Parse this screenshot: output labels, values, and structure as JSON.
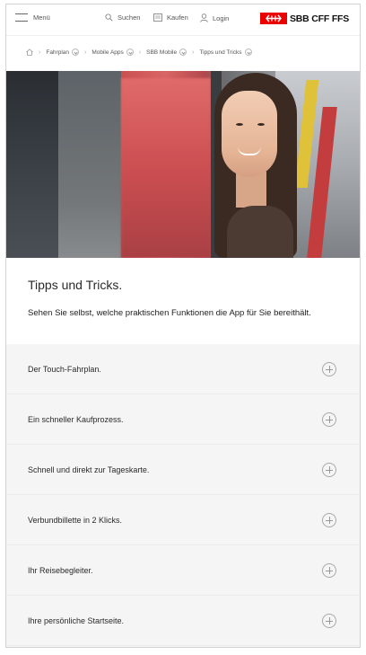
{
  "header": {
    "menu_label": "Menü",
    "search_label": "Suchen",
    "buy_label": "Kaufen",
    "login_label": "Login",
    "logo_text": "SBB CFF FFS",
    "brand_color": "#eb0000"
  },
  "breadcrumb": {
    "items": [
      {
        "label": "Fahrplan"
      },
      {
        "label": "Mobile Apps"
      },
      {
        "label": "SBB Mobile"
      },
      {
        "label": "Tipps und Tricks"
      }
    ]
  },
  "intro": {
    "title": "Tipps und Tricks.",
    "text": "Sehen Sie selbst, welche praktischen Funktionen die App für Sie bereithält."
  },
  "accordion": {
    "items": [
      {
        "label": "Der Touch-Fahrplan."
      },
      {
        "label": "Ein schneller Kaufprozess."
      },
      {
        "label": "Schnell und direkt zur Tageskarte."
      },
      {
        "label": "Verbundbillette in 2 Klicks."
      },
      {
        "label": "Ihr Reisebegleiter."
      },
      {
        "label": "Ihre persönliche Startseite."
      }
    ]
  },
  "icons": {
    "menu": "hamburger-icon",
    "search": "search-icon",
    "buy": "ticket-icon",
    "login": "user-icon",
    "home": "home-icon",
    "expand": "plus-circle-icon"
  }
}
